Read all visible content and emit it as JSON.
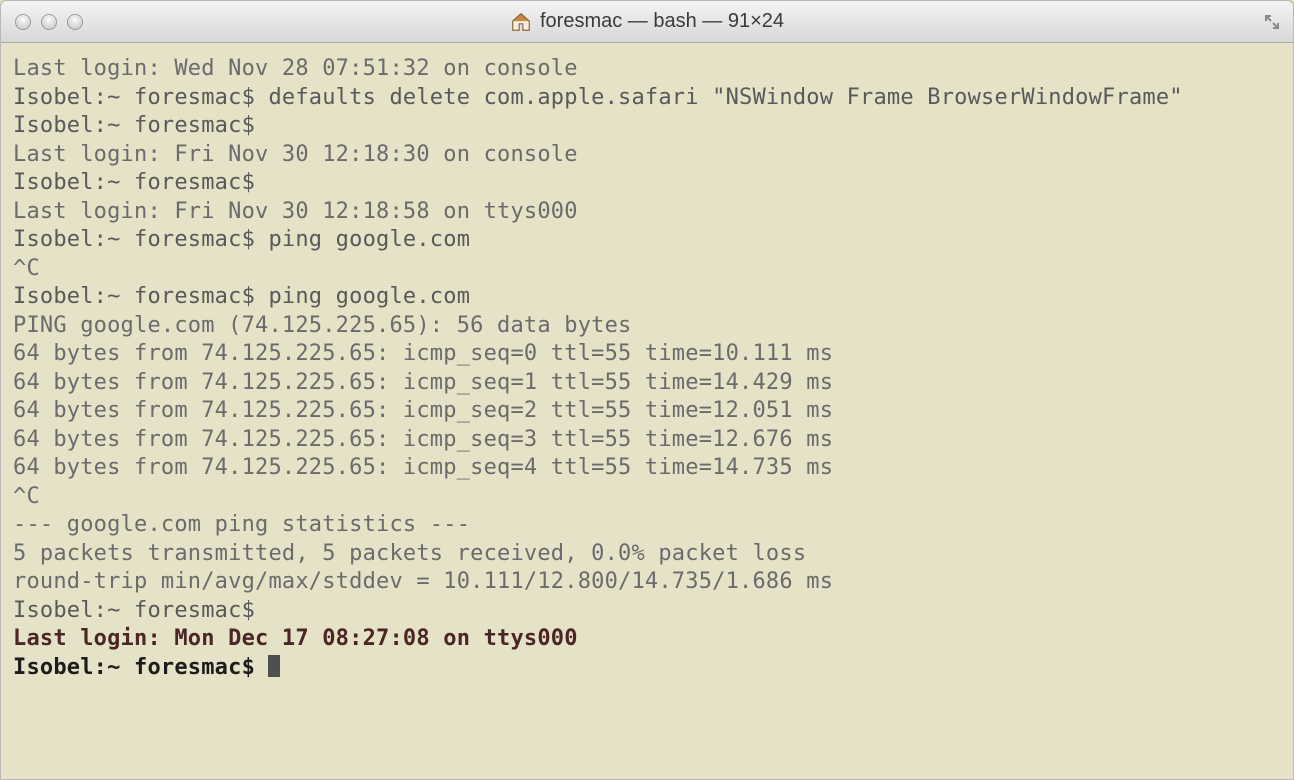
{
  "titlebar": {
    "title": "foresmac — bash — 91×24"
  },
  "terminal": {
    "lines": [
      {
        "cls": "dim",
        "text": "Last login: Wed Nov 28 07:51:32 on console"
      },
      {
        "cls": "promptline",
        "text": "Isobel:~ foresmac$ defaults delete com.apple.safari \"NSWindow Frame BrowserWindowFrame\""
      },
      {
        "cls": "promptline",
        "text": "Isobel:~ foresmac$"
      },
      {
        "cls": "dim",
        "text": "Last login: Fri Nov 30 12:18:30 on console"
      },
      {
        "cls": "promptline",
        "text": "Isobel:~ foresmac$"
      },
      {
        "cls": "dim",
        "text": "Last login: Fri Nov 30 12:18:58 on ttys000"
      },
      {
        "cls": "promptline",
        "text": "Isobel:~ foresmac$ ping google.com"
      },
      {
        "cls": "dim",
        "text": "^C"
      },
      {
        "cls": "promptline",
        "text": "Isobel:~ foresmac$ ping google.com"
      },
      {
        "cls": "dim",
        "text": "PING google.com (74.125.225.65): 56 data bytes"
      },
      {
        "cls": "dim",
        "text": "64 bytes from 74.125.225.65: icmp_seq=0 ttl=55 time=10.111 ms"
      },
      {
        "cls": "dim",
        "text": "64 bytes from 74.125.225.65: icmp_seq=1 ttl=55 time=14.429 ms"
      },
      {
        "cls": "dim",
        "text": "64 bytes from 74.125.225.65: icmp_seq=2 ttl=55 time=12.051 ms"
      },
      {
        "cls": "dim",
        "text": "64 bytes from 74.125.225.65: icmp_seq=3 ttl=55 time=12.676 ms"
      },
      {
        "cls": "dim",
        "text": "64 bytes from 74.125.225.65: icmp_seq=4 ttl=55 time=14.735 ms"
      },
      {
        "cls": "dim",
        "text": "^C"
      },
      {
        "cls": "dim",
        "text": "--- google.com ping statistics ---"
      },
      {
        "cls": "dim",
        "text": "5 packets transmitted, 5 packets received, 0.0% packet loss"
      },
      {
        "cls": "dim",
        "text": "round-trip min/avg/max/stddev = 10.111/12.800/14.735/1.686 ms"
      },
      {
        "cls": "promptline",
        "text": "Isobel:~ foresmac$"
      },
      {
        "cls": "highlight",
        "text": "Last login: Mon Dec 17 08:27:08 on ttys000"
      },
      {
        "cls": "strong",
        "text": "Isobel:~ foresmac$ ",
        "cursor": true
      }
    ]
  }
}
